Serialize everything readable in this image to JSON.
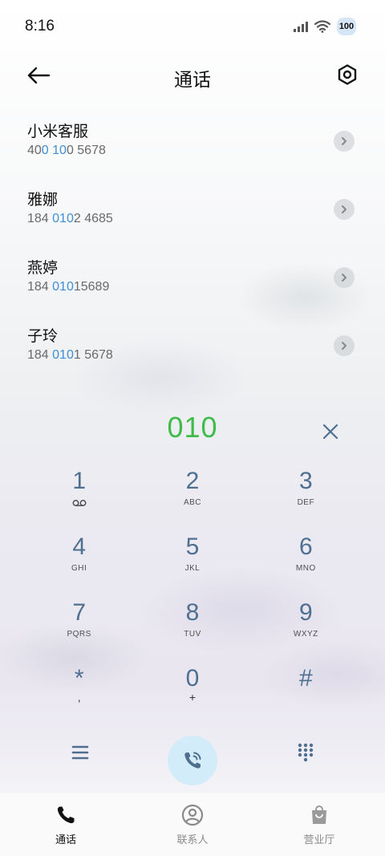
{
  "status_bar": {
    "time": "8:16",
    "battery": "100"
  },
  "header": {
    "title": "通话"
  },
  "contacts": [
    {
      "name": "小米客服",
      "number_pre": "40",
      "number_match": "0 10",
      "number_post": "0 5678"
    },
    {
      "name": "雅娜",
      "number_pre": "184 ",
      "number_match": "010",
      "number_post": "2 4685"
    },
    {
      "name": "燕婷",
      "number_pre": "184 ",
      "number_match": "010",
      "number_post": "15689"
    },
    {
      "name": "子玲",
      "number_pre": "184 ",
      "number_match": "010",
      "number_post": "1 5678"
    }
  ],
  "dialer": {
    "input": "010"
  },
  "keypad": [
    {
      "digit": "1",
      "letters": ""
    },
    {
      "digit": "2",
      "letters": "ABC"
    },
    {
      "digit": "3",
      "letters": "DEF"
    },
    {
      "digit": "4",
      "letters": "GHI"
    },
    {
      "digit": "5",
      "letters": "JKL"
    },
    {
      "digit": "6",
      "letters": "MNO"
    },
    {
      "digit": "7",
      "letters": "PQRS"
    },
    {
      "digit": "8",
      "letters": "TUV"
    },
    {
      "digit": "9",
      "letters": "WXYZ"
    },
    {
      "digit": "*",
      "letters": ","
    },
    {
      "digit": "0",
      "letters": "+"
    },
    {
      "digit": "#",
      "letters": ""
    }
  ],
  "tabs": [
    {
      "label": "通话",
      "icon": "phone-icon",
      "active": true
    },
    {
      "label": "联系人",
      "icon": "person-icon",
      "active": false
    },
    {
      "label": "营业厅",
      "icon": "shopping-bag-icon",
      "active": false
    }
  ],
  "colors": {
    "accent_blue": "#3f8fd6",
    "dial_green": "#3fbb4a",
    "key_digit": "#4f6f91",
    "call_button_bg": "#d3ecfa"
  }
}
